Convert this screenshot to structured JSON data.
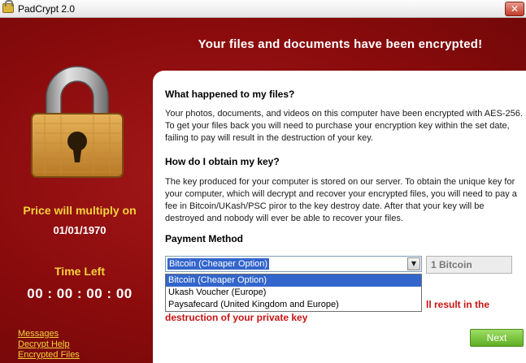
{
  "window": {
    "title": "PadCrypt 2.0",
    "close_glyph": "✕",
    "close_icon": "close-icon"
  },
  "header": {
    "title": "Your files and documents have been encrypted!"
  },
  "left": {
    "lock_icon": "padlock-icon",
    "price_label": "Price will multiply on",
    "price_date": "01/01/1970",
    "time_left_label": "Time Left",
    "timer": "00 : 00 : 00 : 00",
    "links": [
      "Messages",
      "Decrypt Help",
      "Encrypted Files"
    ]
  },
  "panel": {
    "q1": "What happened to my files?",
    "a1": "Your photos, documents, and videos on this computer have been encrypted with AES-256. To get your files back you will need to purchase your encryption key within the set date, failing to pay will result in the destruction of your key.",
    "q2": "How do I obtain my key?",
    "a2": "The key produced for your computer is stored on our server. To obtain the unique key for your computer, which will decrypt and recover your encrypted files, you will need to pay a fee in Bitcoin/UKash/PSC piror to the key destroy date. After that your key will be destroyed and nobody will ever be able to recover your files.",
    "payment_method_label": "Payment Method",
    "payment_selected": "Bitcoin (Cheaper Option)",
    "payment_options": [
      "Bitcoin (Cheaper Option)",
      "Ukash Voucher (Europe)",
      "Paysafecard (United Kingdom and Europe)"
    ],
    "dropdown_arrow": "▼",
    "amount": "1 Bitcoin",
    "warning_line1": "ll result in the",
    "warning_line2": "destruction of your private key",
    "next_button": "Next"
  },
  "colors": {
    "background": "#8b0c0c",
    "accent_yellow": "#f3d23c",
    "warning_red": "#c81313",
    "next_green": "#5fae22",
    "selection_blue": "#3366cc"
  }
}
